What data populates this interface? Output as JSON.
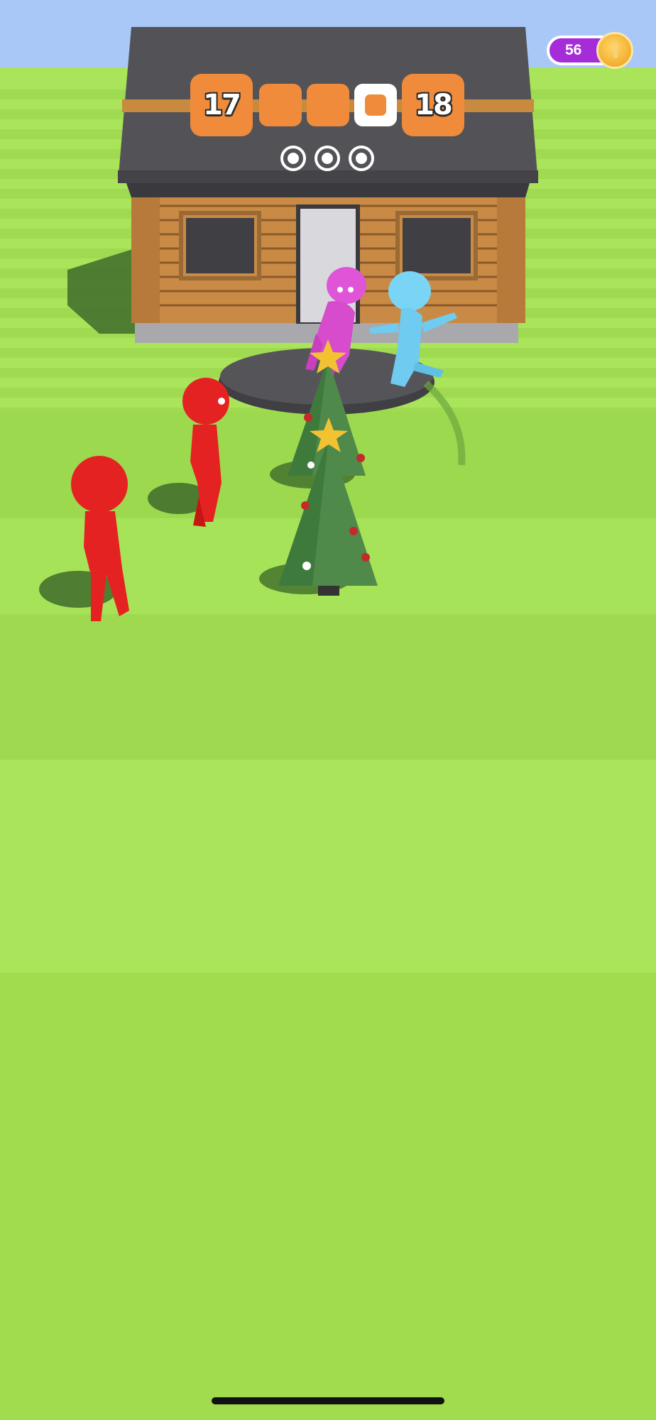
{
  "hud": {
    "current_level": "17",
    "next_level": "18",
    "stages_total": 4,
    "stages_completed": 3,
    "dots_count": 3
  },
  "coins": {
    "amount": "56"
  },
  "colors": {
    "accent": "#ef8b3b",
    "coin_pill": "#a62bd9",
    "enemy": "#e52222",
    "player_pink": "#e055d8",
    "player_blue": "#7ad4f5",
    "tree": "#4f8a4b"
  },
  "icons": {
    "coin": "coin-icon",
    "stage_dot": "target-dot-icon"
  }
}
